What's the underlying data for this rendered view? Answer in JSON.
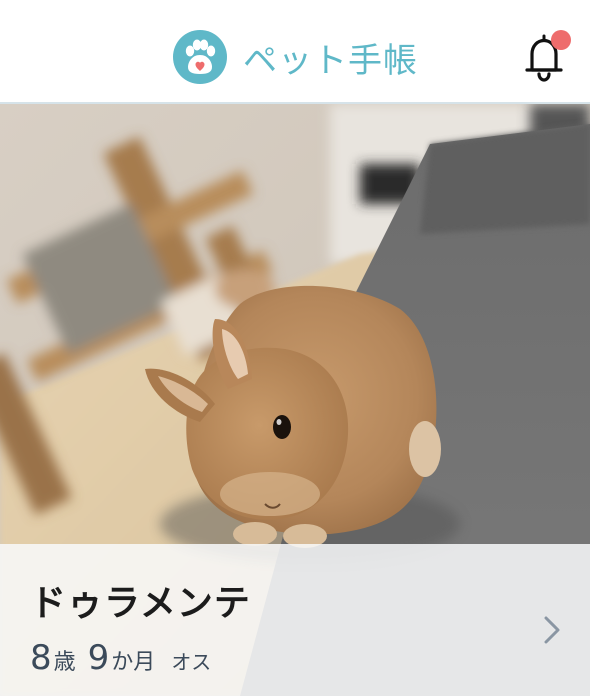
{
  "header": {
    "app_title": "ペット手帳",
    "logo_icon": "paw-heart-icon",
    "notification_icon": "bell-icon",
    "has_unread_notification": true
  },
  "pet": {
    "name": "ドゥラメンテ",
    "age_years": "8",
    "age_years_unit": "歳",
    "age_months": "9",
    "age_months_unit": "か月",
    "sex": "オス",
    "photo_subject": "rabbit-photo",
    "detail_icon": "chevron-right-icon"
  },
  "colors": {
    "brand": "#5fb8c8",
    "notification_dot": "#ee6c6c",
    "divider": "#d6e3e9"
  }
}
